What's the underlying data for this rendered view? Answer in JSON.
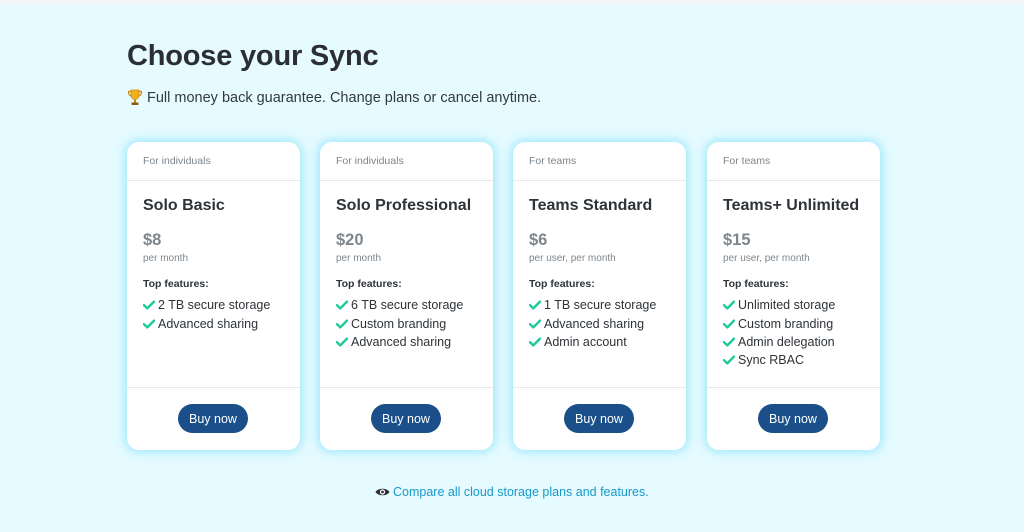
{
  "page": {
    "title": "Choose your Sync",
    "subtitle": "Full money back guarantee. Change plans or cancel anytime.",
    "subtitle_icon": "trophy-icon"
  },
  "colors": {
    "background": "#e6fbff",
    "card": "#ffffff",
    "button": "#1a4f8a",
    "check": "#1ec99a",
    "link": "#1798c9",
    "muted": "#7d868d"
  },
  "features_label": "Top features:",
  "plans": [
    {
      "audience": "For individuals",
      "name": "Solo Basic",
      "price": "$8",
      "period": "per month",
      "features": [
        "2 TB secure storage",
        "Advanced sharing"
      ],
      "button": "Buy now"
    },
    {
      "audience": "For individuals",
      "name": "Solo Professional",
      "price": "$20",
      "period": "per month",
      "features": [
        "6 TB secure storage",
        "Custom branding",
        "Advanced sharing"
      ],
      "button": "Buy now"
    },
    {
      "audience": "For teams",
      "name": "Teams Standard",
      "price": "$6",
      "period": "per user, per month",
      "features": [
        "1 TB secure storage",
        "Advanced sharing",
        "Admin account"
      ],
      "button": "Buy now"
    },
    {
      "audience": "For teams",
      "name": "Teams+ Unlimited",
      "price": "$15",
      "period": "per user, per month",
      "features": [
        "Unlimited storage",
        "Custom branding",
        "Admin delegation",
        "Sync RBAC"
      ],
      "button": "Buy now"
    }
  ],
  "compare_link": {
    "icon": "eye-icon",
    "text": "Compare all cloud storage plans and features."
  }
}
